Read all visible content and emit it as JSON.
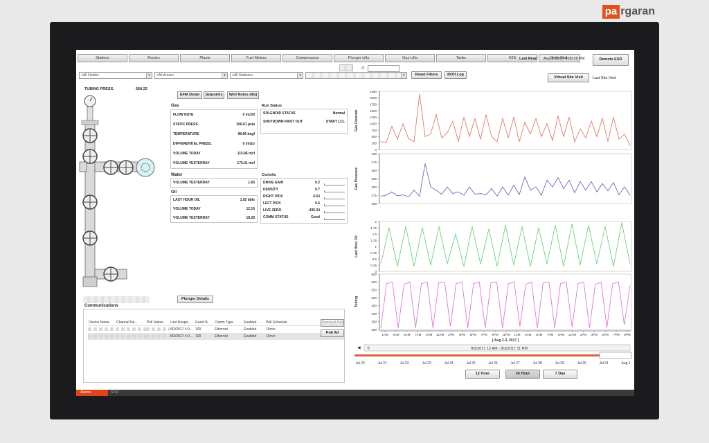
{
  "brand": {
    "badge": "pa",
    "rest": "rgaran"
  },
  "tabs": [
    "Stations",
    "Routes",
    "Plants",
    "Fuel Meters",
    "Compressors",
    "Plunger Lifts",
    "Gas Lifts",
    "Tanks",
    "H2S",
    "Daily Ordi."
  ],
  "header": {
    "last_read_label": "Last Read",
    "last_read_value": "Aug 3, 2017 4:09:16 PM",
    "remote_esd": "Remote ESD",
    "virtual_site_visit": "Virtual Site Visit",
    "last_site_visit": "Last Site Visit"
  },
  "filters": {
    "fields": "<All Fields>",
    "areas": "<All Areas>",
    "stations": "<All Stations>",
    "reset": "Reset Filters",
    "roh": "ROH Log"
  },
  "tubing": {
    "label": "TUBING PRESS.",
    "value": "569.22"
  },
  "well_buttons": {
    "efm": "EFM Detail",
    "setpoints": "Setpoints",
    "notes": "Well Notes (4G)"
  },
  "gas": {
    "title": "Gas",
    "rows": [
      {
        "label": "FLOW RATE",
        "value": "0 mcf/d"
      },
      {
        "label": "STATIC PRESS.",
        "value": "266.61 psia"
      },
      {
        "label": "TEMPERATURE",
        "value": "98.66 degf"
      },
      {
        "label": "DIFFERENTIAL PRESS.",
        "value": "0 inh2o"
      },
      {
        "label": "VOLUME TODAY",
        "value": "115.86 mcf"
      },
      {
        "label": "VOLUME YESTERDAY",
        "value": "175.01 mcf"
      }
    ]
  },
  "run_status": {
    "title": "Run Status",
    "rows": [
      {
        "label": "SOLENOID STATUS",
        "value": "Normal"
      },
      {
        "label": "SHUTDOWN FIRST OUT",
        "value": "START LCL"
      }
    ]
  },
  "water": {
    "title": "Water",
    "rows": [
      {
        "label": "VOLUME YESTERDAY",
        "value": "1.65"
      }
    ]
  },
  "oil": {
    "title": "Oil",
    "rows": [
      {
        "label": "LAST HOUR OIL",
        "value": "1.02 bbls"
      },
      {
        "label": "VOLUME TODAY",
        "value": "12.16"
      },
      {
        "label": "VOLUME YESTERDAY",
        "value": "18.28"
      }
    ]
  },
  "coriolis": {
    "title": "Coriolis",
    "rows": [
      {
        "label": "DRIVE GAIN",
        "value": "0.2"
      },
      {
        "label": "DENSITY",
        "value": "0.7"
      },
      {
        "label": "RIGHT PICK",
        "value": "0.63"
      },
      {
        "label": "LEFT PICK",
        "value": "0.6"
      },
      {
        "label": "LIVE ZERO",
        "value": "-435.34"
      },
      {
        "label": "COMM STATUS",
        "value": "Good"
      }
    ]
  },
  "plunger_details": "Plunger Details",
  "communications": {
    "title": "Communications",
    "columns": [
      "Device Name",
      "Channel Na...",
      "Poll Status",
      "Last Respo...",
      "Good %",
      "Comm Type",
      "Enabled",
      "Poll Schedule"
    ],
    "rows": [
      [
        "",
        "",
        "",
        "8/3/2017 4:0...",
        "100",
        "Ethernet",
        "Enabled",
        "15min"
      ],
      [
        "",
        "",
        "",
        "8/3/2017 4:0...",
        "100",
        "Ethernet",
        "Enabled",
        "15min"
      ]
    ],
    "demand_poll": "Demand Poll",
    "poll_all": "Poll All"
  },
  "bottom": {
    "alarms": "Alarms",
    "stat": "STAT"
  },
  "timeline": {
    "range_label": "8/2/2017 12 AM - 8/3/2017 11 PM",
    "dates": [
      "Jul 20",
      "Jul 21",
      "Jul 22",
      "Jul 23",
      "Jul 24",
      "Jul 25",
      "Jul 26",
      "Jul 27",
      "Jul 28",
      "Jul 29",
      "Jul 30",
      "Jul 31",
      "Aug 1"
    ],
    "range_buttons": [
      "12 Hour",
      "24 Hour",
      "7 Day"
    ],
    "selected_range": "24 Hour"
  },
  "chart_data": [
    {
      "type": "line",
      "ylabel": "Gas Flowrate",
      "ylim": [
        0,
        2250
      ],
      "yticks": [
        0,
        250,
        500,
        750,
        1000,
        1250,
        1500,
        1750,
        2000,
        2250
      ],
      "color": "#e07a6c",
      "series": [
        {
          "values": [
            300,
            280,
            900,
            400,
            1000,
            420,
            300,
            2150,
            500,
            600,
            1350,
            450,
            650,
            1100,
            300,
            1250,
            500,
            1200,
            400,
            1350,
            500,
            300,
            1200,
            450,
            1250,
            300,
            1050,
            600,
            1200,
            500,
            1000,
            350,
            1300,
            500,
            1250,
            300,
            800,
            450,
            1100,
            500,
            1200,
            300,
            1250,
            400,
            600,
            150
          ]
        }
      ]
    },
    {
      "type": "line",
      "ylabel": "Gas Pressure",
      "ylim": [
        250,
        400
      ],
      "yticks": [
        250,
        275,
        300,
        325,
        350,
        375,
        400
      ],
      "color": "#6b6bbd",
      "series": [
        {
          "values": [
            272,
            275,
            285,
            273,
            276,
            270,
            290,
            272,
            370,
            300,
            290,
            278,
            300,
            280,
            285,
            275,
            300,
            278,
            280,
            276,
            295,
            272,
            300,
            275,
            305,
            277,
            330,
            290,
            300,
            275,
            320,
            300,
            328,
            295,
            320,
            282,
            316,
            290,
            316,
            285,
            310,
            288,
            313,
            276,
            300,
            275
          ]
        }
      ]
    },
    {
      "type": "line",
      "ylabel": "Last Hour Oil",
      "ylim": [
        0,
        2
      ],
      "yticks": [
        0,
        0.25,
        0.5,
        0.75,
        1,
        1.25,
        1.5,
        1.75,
        2
      ],
      "color": "#6ed07a",
      "series": [
        {
          "values": [
            0.3,
            1.75,
            0.2,
            1.8,
            0.2,
            1.75,
            0.25,
            1.8,
            0.3,
            1.5,
            0.2,
            1.8,
            0.3,
            1.7,
            0.2,
            1.85,
            0.25,
            1.8,
            0.2,
            1.75,
            0.3,
            1.85,
            0.2,
            1.9,
            0.25,
            1.85,
            0.3,
            1.8,
            0.2,
            1.95,
            0.3
          ]
        }
      ]
    },
    {
      "type": "line",
      "ylabel": "Tubing",
      "ylim": [
        300,
        650
      ],
      "yticks": [
        300,
        350,
        400,
        450,
        500,
        550,
        600,
        650
      ],
      "color": "#d77ad7",
      "series": [
        {
          "values": [
            310,
            590,
            600,
            310,
            585,
            600,
            310,
            590,
            600,
            310,
            595,
            600,
            320,
            590,
            600,
            310,
            590,
            600,
            310,
            595,
            600,
            310,
            590,
            600,
            320,
            585,
            600,
            310,
            595,
            600,
            310,
            590,
            600,
            315,
            590,
            600,
            310,
            585,
            600,
            310,
            590,
            600,
            330,
            580
          ]
        }
      ]
    }
  ],
  "x_axis": {
    "ticks": [
      "1AM",
      "3AM",
      "5AM",
      "7AM",
      "9AM",
      "11AM",
      "1PM",
      "3PM",
      "5PM",
      "7PM",
      "9PM",
      "11PM",
      "1AM",
      "3AM",
      "5AM",
      "7AM",
      "9AM",
      "11AM",
      "1PM",
      "3PM",
      "5PM",
      "7PM",
      "9PM"
    ],
    "title": "[ Aug 2-3, 2017 ]"
  }
}
